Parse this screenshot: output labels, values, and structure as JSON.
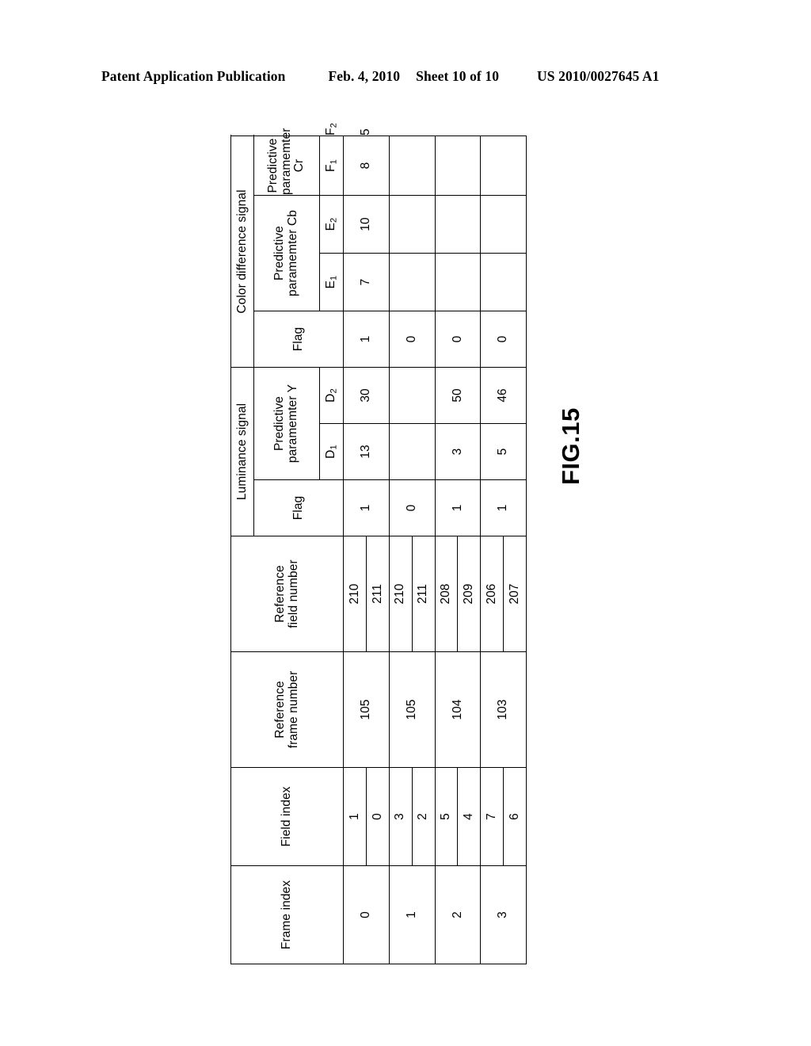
{
  "header": {
    "publication": "Patent Application Publication",
    "date": "Feb. 4, 2010",
    "sheet": "Sheet 10 of 10",
    "patent_number": "US 2010/0027645 A1"
  },
  "figure": {
    "label": "FIG.15"
  },
  "table": {
    "headers": {
      "frame_index": "Frame index",
      "field_index": "Field index",
      "reference_frame_number": "Reference\nframe number",
      "reference_frame_number_l1": "Reference",
      "reference_frame_number_l2": "frame number",
      "reference_field_number_l1": "Reference",
      "reference_field_number_l2": "field number",
      "luminance_signal": "Luminance signal",
      "color_difference_signal": "Color difference signal",
      "flag": "Flag",
      "predictive_parameter_y_l1": "Predictive",
      "predictive_parameter_y_l2": "paramemter Y",
      "predictive_parameter_cb_l1": "Predictive",
      "predictive_parameter_cb_l2": "paramemter Cb",
      "predictive_parameter_cr_l1": "Predictive",
      "predictive_parameter_cr_l2": "paramemter Cr",
      "d1": "D1",
      "d2": "D2",
      "e1": "E1",
      "e2": "E2",
      "f1": "F1",
      "f2": "F2"
    },
    "rows": [
      {
        "frame_index": "0",
        "reference_frame_number": "105",
        "fields": [
          {
            "field_index": "1",
            "reference_field_number": "210"
          },
          {
            "field_index": "0",
            "reference_field_number": "211"
          }
        ],
        "luma_flag": "1",
        "d1": "13",
        "d2": "30",
        "chroma_flag": "1",
        "e1": "7",
        "e2": "10",
        "f1": "8",
        "f2": "5"
      },
      {
        "frame_index": "1",
        "reference_frame_number": "105",
        "fields": [
          {
            "field_index": "3",
            "reference_field_number": "210"
          },
          {
            "field_index": "2",
            "reference_field_number": "211"
          }
        ],
        "luma_flag": "0",
        "d1": "",
        "d2": "",
        "chroma_flag": "0",
        "e1": "",
        "e2": "",
        "f1": "",
        "f2": ""
      },
      {
        "frame_index": "2",
        "reference_frame_number": "104",
        "fields": [
          {
            "field_index": "5",
            "reference_field_number": "208"
          },
          {
            "field_index": "4",
            "reference_field_number": "209"
          }
        ],
        "luma_flag": "1",
        "d1": "3",
        "d2": "50",
        "chroma_flag": "0",
        "e1": "",
        "e2": "",
        "f1": "",
        "f2": ""
      },
      {
        "frame_index": "3",
        "reference_frame_number": "103",
        "fields": [
          {
            "field_index": "7",
            "reference_field_number": "206"
          },
          {
            "field_index": "6",
            "reference_field_number": "207"
          }
        ],
        "luma_flag": "1",
        "d1": "5",
        "d2": "46",
        "chroma_flag": "0",
        "e1": "",
        "e2": "",
        "f1": "",
        "f2": ""
      }
    ]
  }
}
